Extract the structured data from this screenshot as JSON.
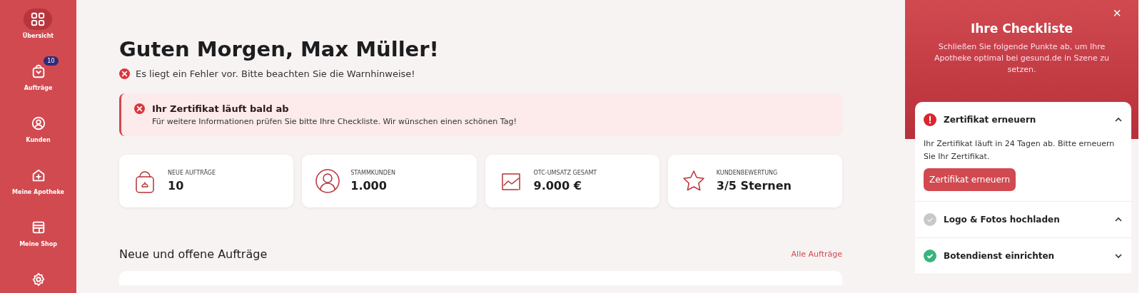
{
  "sidebar": {
    "items": [
      {
        "kind": "grid",
        "label": "Übersicht",
        "selected": true
      },
      {
        "kind": "bag",
        "label": "Aufträge",
        "selected": false,
        "badge": "10"
      },
      {
        "kind": "user",
        "label": "Kunden",
        "selected": false
      },
      {
        "kind": "house",
        "label": "Meine Apotheke",
        "selected": false
      },
      {
        "kind": "shop",
        "label": "Meine Shop",
        "selected": false
      },
      {
        "kind": "gear",
        "selected": false
      }
    ]
  },
  "greeting": "Guten Morgen, Max Müller!",
  "error_message": "Es liegt ein Fehler vor. Bitte beachten Sie die Warnhinweise!",
  "alert": {
    "title": "Ihr Zertifikat läuft bald ab",
    "text": "Für weitere Informationen prüfen Sie bitte Ihre Checkliste. Wir wünschen einen schönen Tag!"
  },
  "stats": [
    {
      "kind": "bag",
      "label": "NEUE AUFTRÄGE",
      "value": "10"
    },
    {
      "kind": "person",
      "label": "STAMMKUNDEN",
      "value": "1.000"
    },
    {
      "kind": "chart",
      "label": "OTC-UMSATZ GESAMT",
      "value": "9.000 €"
    },
    {
      "kind": "star",
      "label": "KUNDENBEWERTUNG",
      "value": "3/5 Sternen"
    }
  ],
  "orders": {
    "title": "Neue und offene Aufträge",
    "link": "Alle Aufträge"
  },
  "checklist": {
    "title": "Ihre Checkliste",
    "subtitle": "Schließen Sie folgende Punkte ab, um Ihre Apotheke optimal bei gesund.de in Szene zu setzen.",
    "close": "×",
    "items": [
      {
        "kind": "error",
        "title": "Zertifikat erneuern",
        "expanded": true,
        "text": "Ihr Zertifikat läuft in 24 Tagen ab. Bitte erneuern Sie Ihr Zertifikat.",
        "button": "Zertifikat erneuern"
      },
      {
        "kind": "pending",
        "title": "Logo & Fotos hochladen",
        "expanded": true
      },
      {
        "kind": "done",
        "title": "Botendienst einrichten",
        "expanded": false
      }
    ]
  }
}
